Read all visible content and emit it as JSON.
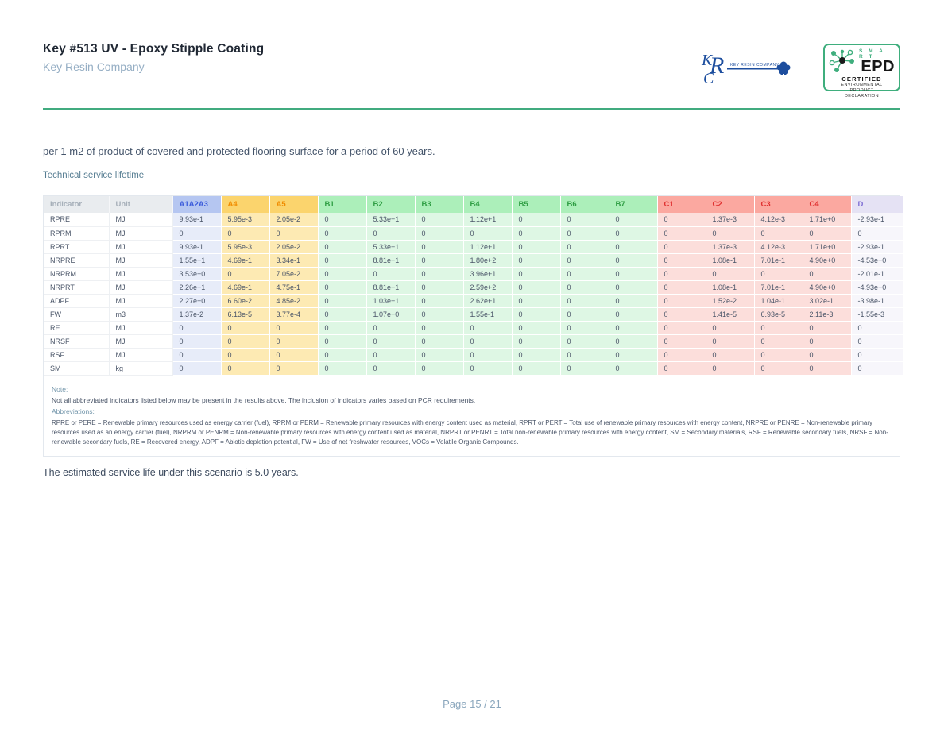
{
  "header": {
    "title": "Key #513 UV - Epoxy Stipple Coating",
    "company": "Key Resin Company",
    "krc_logo": {
      "letters": "KRC",
      "text": "Key Resin Company"
    },
    "epd_badge": {
      "smart": "S M A R T",
      "epd": "EPD",
      "certified": "CERTIFIED",
      "line1": "ENVIRONMENTAL PRODUCT",
      "line2": "DECLARATION"
    }
  },
  "intro": {
    "functional_unit": "per 1 m2 of product of covered and protected flooring surface for a period of 60 years.",
    "section_label": "Technical service lifetime"
  },
  "table": {
    "columns": [
      {
        "label": "Indicator",
        "group": "meta"
      },
      {
        "label": "Unit",
        "group": "meta"
      },
      {
        "label": "A1A2A3",
        "group": "a1"
      },
      {
        "label": "A4",
        "group": "a"
      },
      {
        "label": "A5",
        "group": "a"
      },
      {
        "label": "B1",
        "group": "b"
      },
      {
        "label": "B2",
        "group": "b"
      },
      {
        "label": "B3",
        "group": "b"
      },
      {
        "label": "B4",
        "group": "b"
      },
      {
        "label": "B5",
        "group": "b"
      },
      {
        "label": "B6",
        "group": "b"
      },
      {
        "label": "B7",
        "group": "b"
      },
      {
        "label": "C1",
        "group": "c"
      },
      {
        "label": "C2",
        "group": "c"
      },
      {
        "label": "C3",
        "group": "c"
      },
      {
        "label": "C4",
        "group": "c"
      },
      {
        "label": "D",
        "group": "d"
      }
    ],
    "rows": [
      {
        "indicator": "RPRE",
        "unit": "MJ",
        "values": [
          "9.93e-1",
          "5.95e-3",
          "2.05e-2",
          "0",
          "5.33e+1",
          "0",
          "1.12e+1",
          "0",
          "0",
          "0",
          "0",
          "1.37e-3",
          "4.12e-3",
          "1.71e+0",
          "-2.93e-1"
        ]
      },
      {
        "indicator": "RPRM",
        "unit": "MJ",
        "values": [
          "0",
          "0",
          "0",
          "0",
          "0",
          "0",
          "0",
          "0",
          "0",
          "0",
          "0",
          "0",
          "0",
          "0",
          "0"
        ]
      },
      {
        "indicator": "RPRT",
        "unit": "MJ",
        "values": [
          "9.93e-1",
          "5.95e-3",
          "2.05e-2",
          "0",
          "5.33e+1",
          "0",
          "1.12e+1",
          "0",
          "0",
          "0",
          "0",
          "1.37e-3",
          "4.12e-3",
          "1.71e+0",
          "-2.93e-1"
        ]
      },
      {
        "indicator": "NRPRE",
        "unit": "MJ",
        "values": [
          "1.55e+1",
          "4.69e-1",
          "3.34e-1",
          "0",
          "8.81e+1",
          "0",
          "1.80e+2",
          "0",
          "0",
          "0",
          "0",
          "1.08e-1",
          "7.01e-1",
          "4.90e+0",
          "-4.53e+0"
        ]
      },
      {
        "indicator": "NRPRM",
        "unit": "MJ",
        "values": [
          "3.53e+0",
          "0",
          "7.05e-2",
          "0",
          "0",
          "0",
          "3.96e+1",
          "0",
          "0",
          "0",
          "0",
          "0",
          "0",
          "0",
          "-2.01e-1"
        ]
      },
      {
        "indicator": "NRPRT",
        "unit": "MJ",
        "values": [
          "2.26e+1",
          "4.69e-1",
          "4.75e-1",
          "0",
          "8.81e+1",
          "0",
          "2.59e+2",
          "0",
          "0",
          "0",
          "0",
          "1.08e-1",
          "7.01e-1",
          "4.90e+0",
          "-4.93e+0"
        ]
      },
      {
        "indicator": "ADPF",
        "unit": "MJ",
        "values": [
          "2.27e+0",
          "6.60e-2",
          "4.85e-2",
          "0",
          "1.03e+1",
          "0",
          "2.62e+1",
          "0",
          "0",
          "0",
          "0",
          "1.52e-2",
          "1.04e-1",
          "3.02e-1",
          "-3.98e-1"
        ]
      },
      {
        "indicator": "FW",
        "unit": "m3",
        "values": [
          "1.37e-2",
          "6.13e-5",
          "3.77e-4",
          "0",
          "1.07e+0",
          "0",
          "1.55e-1",
          "0",
          "0",
          "0",
          "0",
          "1.41e-5",
          "6.93e-5",
          "2.11e-3",
          "-1.55e-3"
        ]
      },
      {
        "indicator": "RE",
        "unit": "MJ",
        "values": [
          "0",
          "0",
          "0",
          "0",
          "0",
          "0",
          "0",
          "0",
          "0",
          "0",
          "0",
          "0",
          "0",
          "0",
          "0"
        ]
      },
      {
        "indicator": "NRSF",
        "unit": "MJ",
        "values": [
          "0",
          "0",
          "0",
          "0",
          "0",
          "0",
          "0",
          "0",
          "0",
          "0",
          "0",
          "0",
          "0",
          "0",
          "0"
        ]
      },
      {
        "indicator": "RSF",
        "unit": "MJ",
        "values": [
          "0",
          "0",
          "0",
          "0",
          "0",
          "0",
          "0",
          "0",
          "0",
          "0",
          "0",
          "0",
          "0",
          "0",
          "0"
        ]
      },
      {
        "indicator": "SM",
        "unit": "kg",
        "values": [
          "0",
          "0",
          "0",
          "0",
          "0",
          "0",
          "0",
          "0",
          "0",
          "0",
          "0",
          "0",
          "0",
          "0",
          "0"
        ]
      }
    ]
  },
  "notes": {
    "note_label": "Note:",
    "note_text": "Not all abbreviated indicators listed below may be present in the results above. The inclusion of indicators varies based on PCR requirements.",
    "abbreviations_label": "Abbreviations:",
    "abbreviations_text": "RPRE or PERE = Renewable primary resources used as energy carrier (fuel), RPRM or PERM = Renewable primary resources with energy content used as material, RPRT or PERT = Total use of renewable primary resources with energy content, NRPRE or PENRE = Non-renewable primary resources used as an energy carrier (fuel), NRPRM or PENRM = Non-renewable primary resources with energy content used as material, NRPRT or PENRT = Total non-renewable primary resources with energy content, SM = Secondary materials, RSF = Renewable secondary fuels, NRSF = Non-renewable secondary fuels, RE = Recovered energy, ADPF = Abiotic depletion potential, FW = Use of net freshwater resources, VOCs = Volatile Organic Compounds."
  },
  "service_life_text": "The estimated service life under this scenario is 5.0 years.",
  "footer": {
    "page_label": "Page 15 / 21"
  },
  "colors": {
    "divider_green": "#41ab7f",
    "badge_green": "#3fae7d",
    "krc_blue": "#1d4e9e",
    "a1_header": "#b5c6f1",
    "a1_text": "#3b5bdb",
    "a_header": "#fbd46d",
    "a_text": "#f08c00",
    "b_header": "#acefba",
    "b_text": "#2f9e44",
    "c_header": "#fba8a0",
    "c_text": "#e03131",
    "d_header": "#e5e2f4",
    "d_text": "#8070d4"
  }
}
